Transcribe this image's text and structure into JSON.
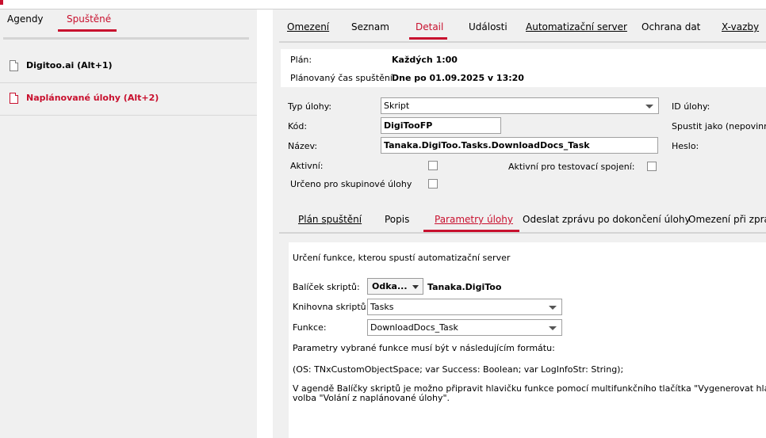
{
  "colors": {
    "accent": "#c8102e",
    "pane": "#f0f0f0"
  },
  "left": {
    "tabs": [
      "Agendy",
      "Spuštěné"
    ],
    "items": [
      {
        "label": "Digitoo.ai (Alt+1)",
        "icon": "document-icon",
        "active": false
      },
      {
        "label": "Naplánované úlohy (Alt+2)",
        "icon": "document-icon",
        "active": true
      }
    ]
  },
  "right": {
    "tabs": [
      "Omezení",
      "Seznam",
      "Detail",
      "Události",
      "Automatizační server",
      "Ochrana dat",
      "X-vazby"
    ],
    "active_tab": "Detail"
  },
  "summary": {
    "plan_label": "Plán:",
    "plan_value": "Každých 1:00",
    "scheduled_label": "Plánovaný čas spuštění:",
    "scheduled_value": "Dne po 01.09.2025 v 13:20"
  },
  "form": {
    "type_label": "Typ úlohy:",
    "type_value": "Skript",
    "code_label": "Kód:",
    "code_value": "DigiTooFP",
    "name_label": "Název:",
    "name_value": "Tanaka.DigiToo.Tasks.DownloadDocs_Task",
    "active_label": "Aktivní:",
    "group_label": "Určeno pro skupinové úlohy",
    "test_label": "Aktivní pro testovací spojení:",
    "id_label": "ID úlohy:",
    "run_as_label": "Spustit jako (nepovinné)",
    "password_label": "Heslo:"
  },
  "subtabs": {
    "items": [
      "Plán spuštění",
      "Popis",
      "Parametry úlohy",
      "Odeslat zprávu po dokončení úlohy",
      "Omezení při zpra"
    ],
    "active": "Parametry úlohy"
  },
  "params": {
    "intro": "Určení funkce, kterou spustí automatizační server",
    "package_label": "Balíček skriptů:",
    "package_button": "Odka...",
    "package_value": "Tanaka.DigiToo",
    "library_label": "Knihovna skriptů:",
    "library_value": "Tasks",
    "function_label": "Funkce:",
    "function_value": "DownloadDocs_Task",
    "format_note": "Parametry vybrané funkce musí být v následujícím formátu:",
    "signature": "(OS: TNxCustomObjectSpace; var Success: Boolean; var LogInfoStr: String);",
    "hint_line1": "V agendě Balíčky skriptů je možno připravit hlavičku funkce pomocí multifunkčního tlačítka \"Vygenerovat hlavičku\",",
    "hint_line2": "volba \"Volání z naplánované úlohy\"."
  }
}
